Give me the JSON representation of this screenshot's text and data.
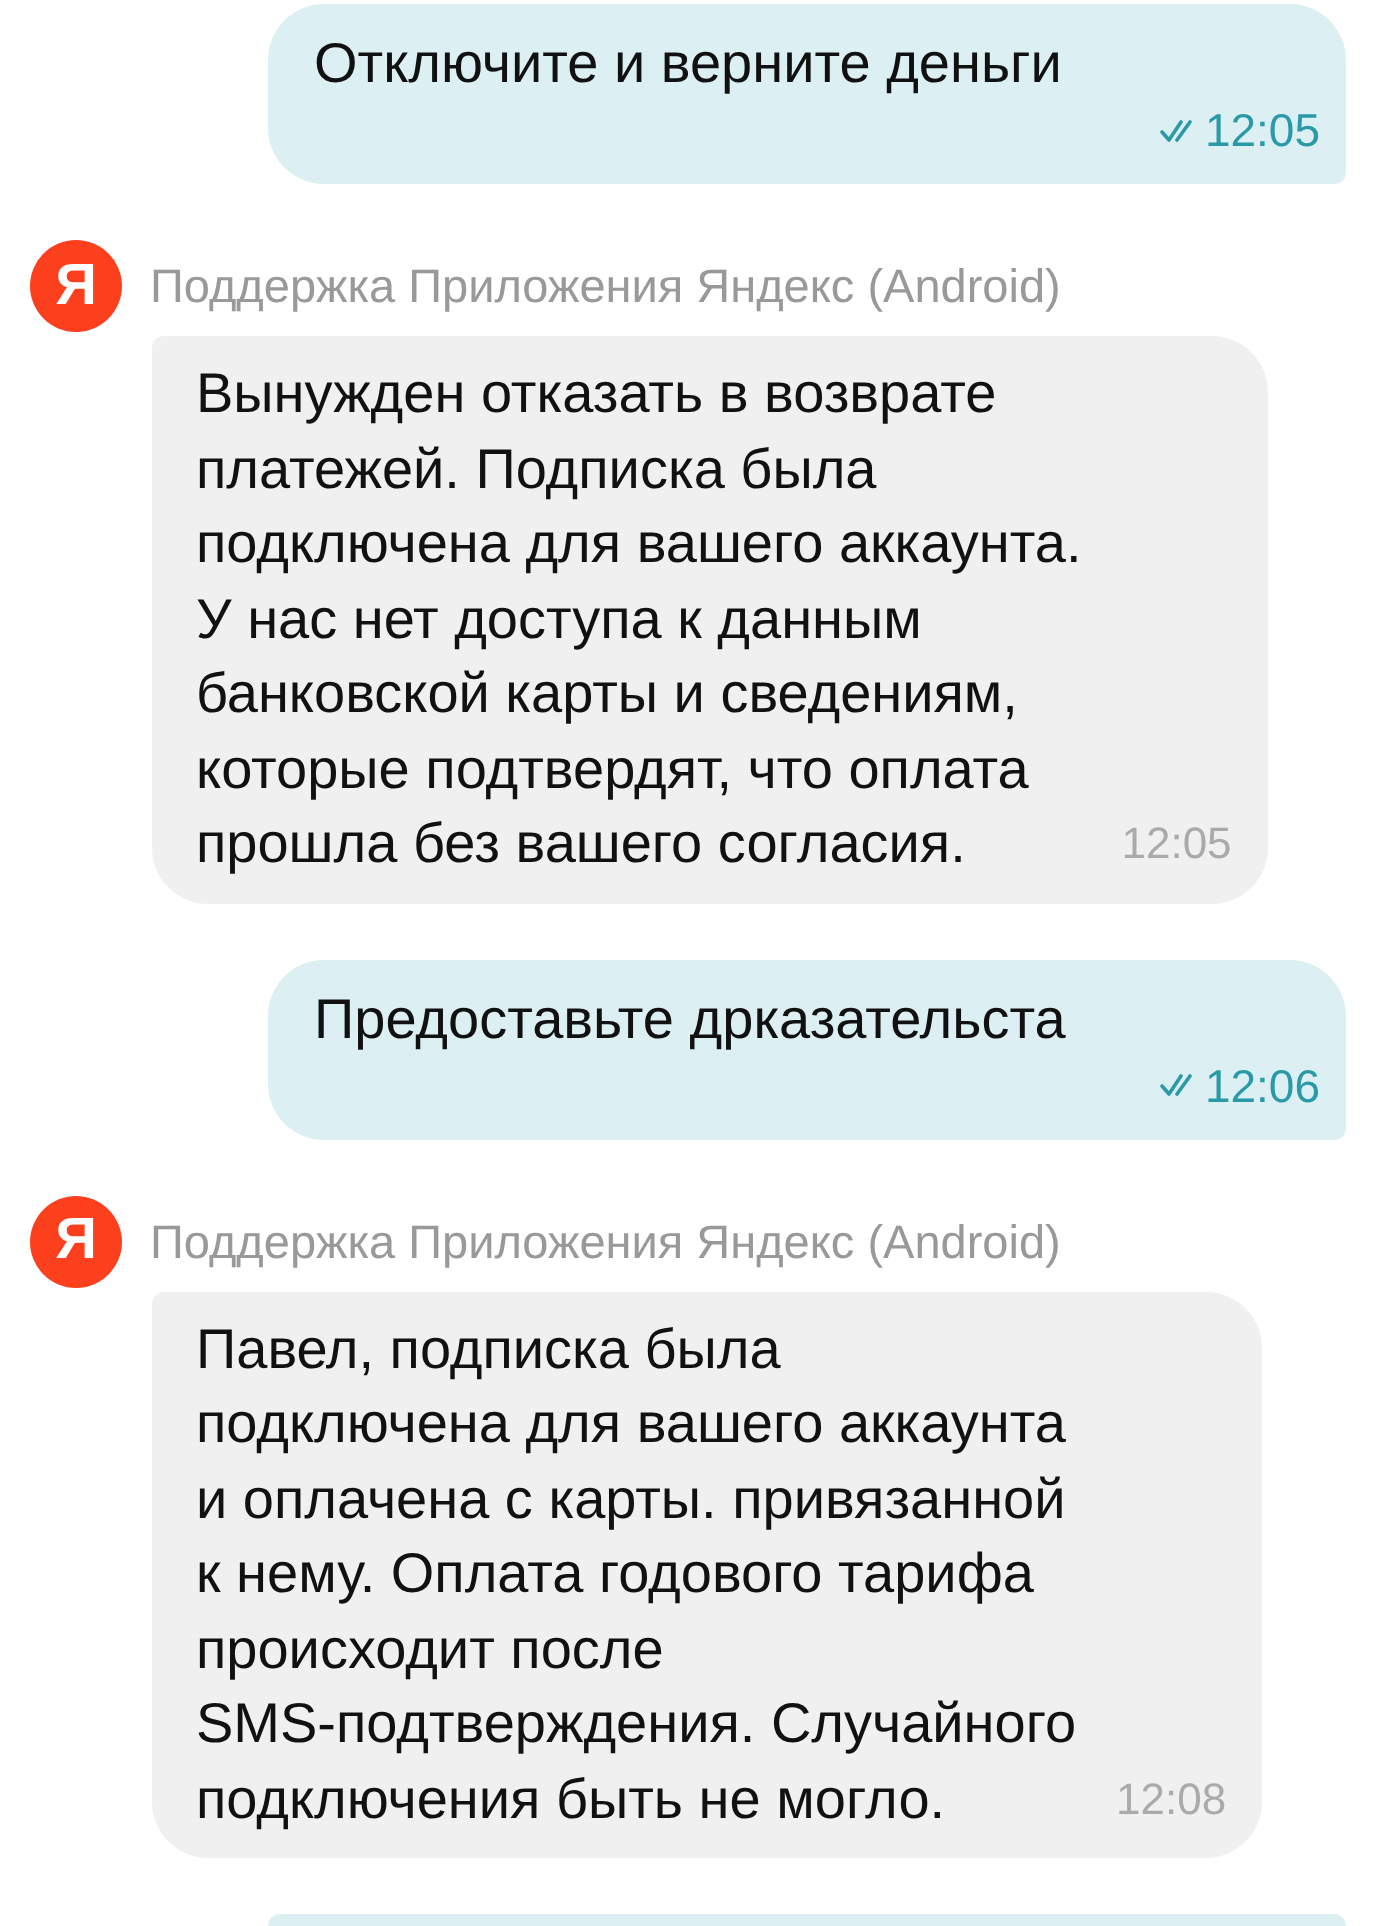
{
  "messages": [
    {
      "kind": "outgoing",
      "text": "Отключите и верните деньги",
      "time": "12:05",
      "read": true
    },
    {
      "kind": "incoming",
      "avatar": "Я",
      "sender": "Поддержка Приложения Яндекс (Android)",
      "text": "Вынужден отказать в возврате\nплатежей. Подписка была\nподключена для вашего аккаунта.\nУ нас нет доступа к данным\nбанковской карты и сведениям,\nкоторые подтвердят, что оплата\nпрошла без вашего согласия.",
      "time": "12:05"
    },
    {
      "kind": "outgoing",
      "text": "Предоставьте дрказательста",
      "time": "12:06",
      "read": true
    },
    {
      "kind": "incoming",
      "avatar": "Я",
      "sender": "Поддержка Приложения Яндекс (Android)",
      "text": "Павел, подписка была\nподключена для вашего аккаунта\nи оплачена с карты. привязанной\nк нему. Оплата годового тарифа\nпроисходит после\nSMS-подтверждения. Случайного\nподключения быть не могло.",
      "time": "12:08"
    },
    {
      "kind": "outgoing"
    }
  ]
}
